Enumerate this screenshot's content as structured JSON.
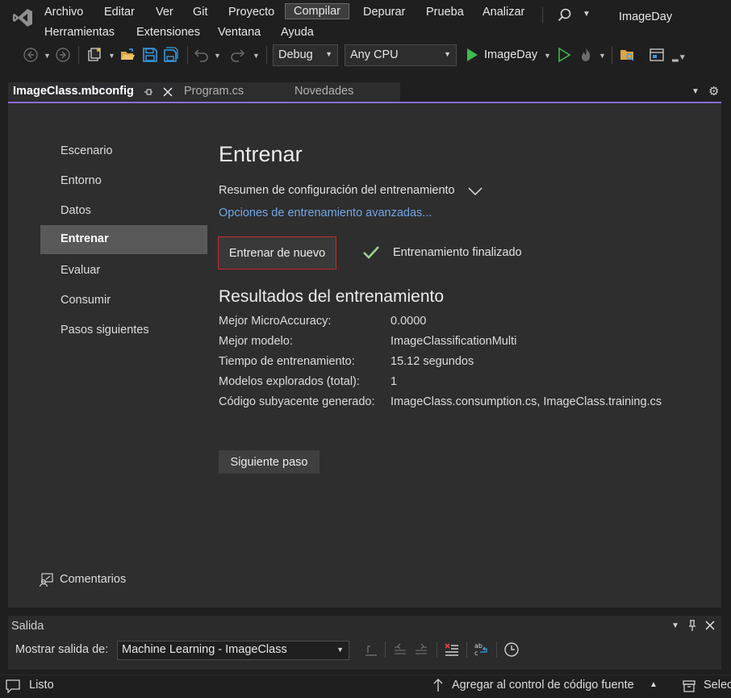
{
  "menu": {
    "items": [
      "Archivo",
      "Editar",
      "Ver",
      "Git",
      "Proyecto",
      "Compilar",
      "Depurar",
      "Prueba",
      "Analizar",
      "Herramientas",
      "Extensiones",
      "Ventana",
      "Ayuda"
    ],
    "active": "Compilar"
  },
  "solution_name": "ImageDay",
  "toolbar": {
    "configuration": "Debug",
    "platform": "Any CPU",
    "start_target": "ImageDay"
  },
  "tabs": [
    {
      "label": "ImageClass.mbconfig",
      "active": true
    },
    {
      "label": "Program.cs",
      "active": false
    },
    {
      "label": "Novedades",
      "active": false
    }
  ],
  "nav": {
    "items": [
      "Escenario",
      "Entorno",
      "Datos",
      "Entrenar",
      "Evaluar",
      "Consumir",
      "Pasos siguientes"
    ],
    "selected": "Entrenar"
  },
  "train": {
    "title": "Entrenar",
    "summary_label": "Resumen de configuración del entrenamiento",
    "advanced_link": "Opciones de entrenamiento avanzadas...",
    "retrain_button": "Entrenar de nuevo",
    "status": "Entrenamiento finalizado",
    "results_title": "Resultados del entrenamiento",
    "results": [
      {
        "label": "Mejor MicroAccuracy:",
        "value": "0.0000"
      },
      {
        "label": "Mejor modelo:",
        "value": "ImageClassificationMulti"
      },
      {
        "label": "Tiempo de entrenamiento:",
        "value": "15.12 segundos"
      },
      {
        "label": "Modelos explorados (total):",
        "value": "1"
      },
      {
        "label": "Código subyacente generado:",
        "value": "ImageClass.consumption.cs, ImageClass.training.cs"
      }
    ],
    "next_button": "Siguiente paso",
    "feedback": "Comentarios"
  },
  "output": {
    "title": "Salida",
    "show_label": "Mostrar salida de:",
    "source": "Machine Learning - ImageClass"
  },
  "status": {
    "text": "Listo",
    "source_control": "Agregar al control de código fuente",
    "repo": "Selec"
  },
  "colors": {
    "accent": "#8a6dd1",
    "link": "#72a7e4",
    "highlight_border": "#c32b2b",
    "check": "#9bd38a",
    "run": "#3fb950"
  }
}
